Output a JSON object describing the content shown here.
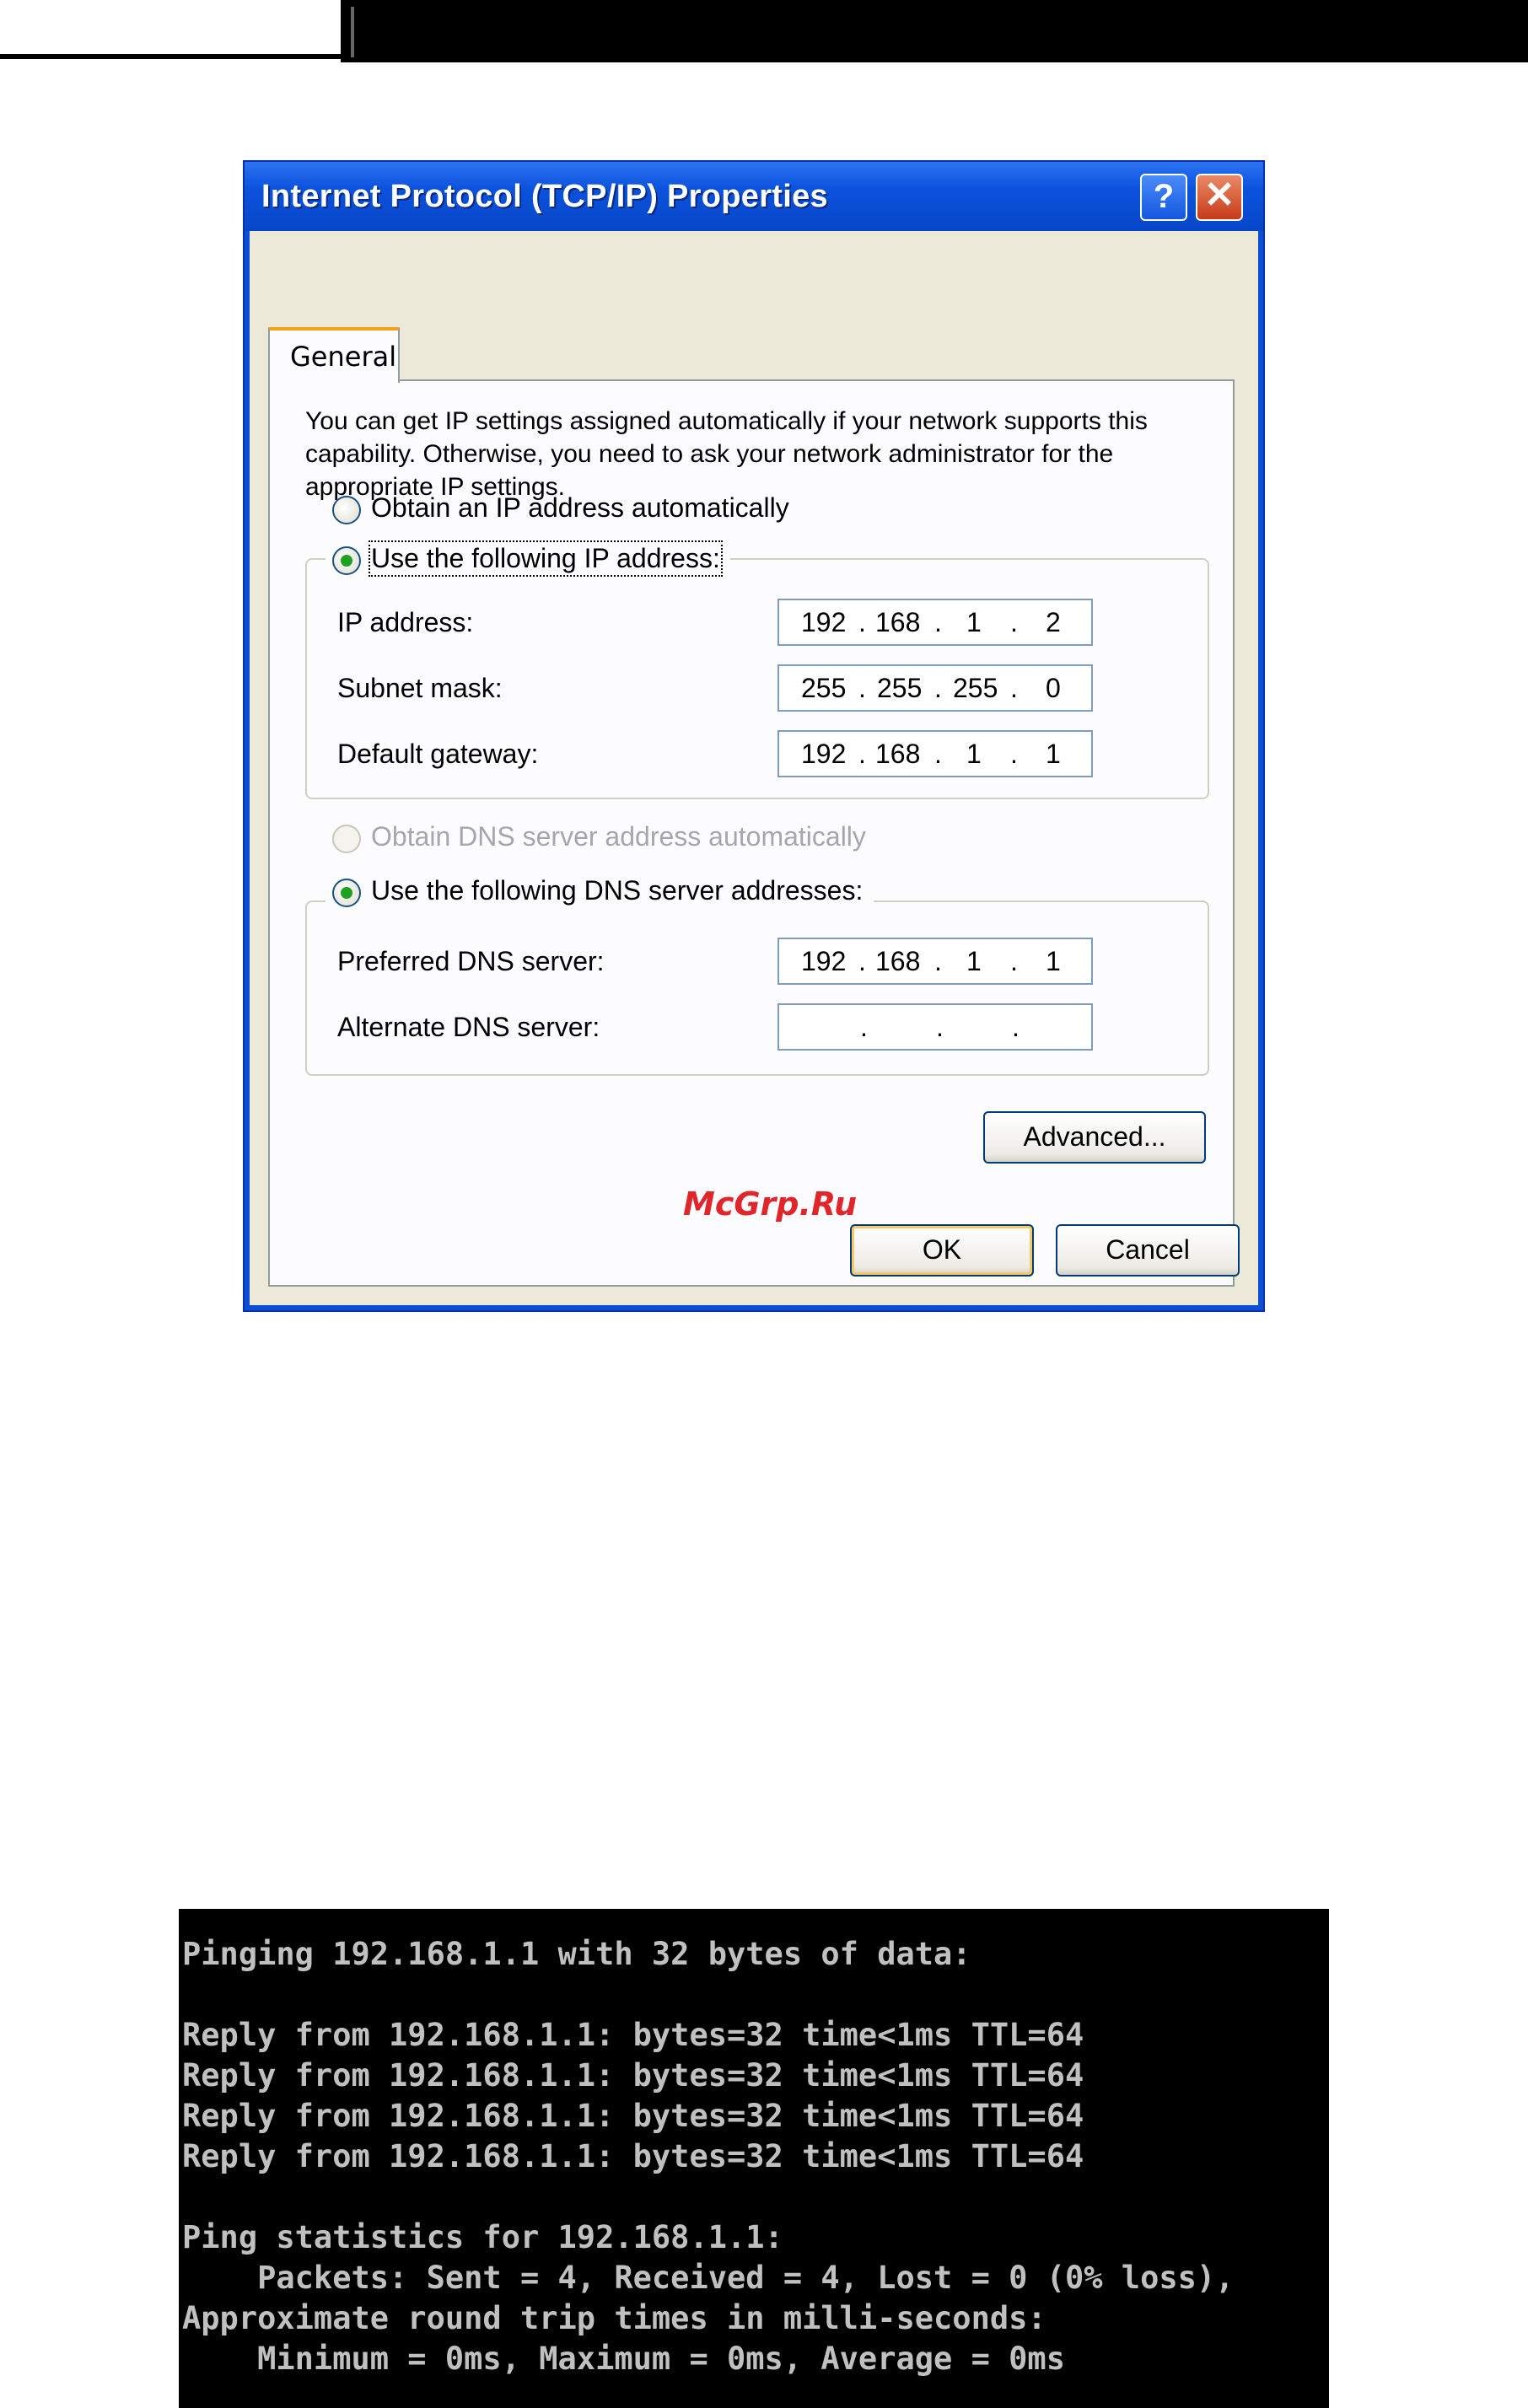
{
  "dialog": {
    "title": "Internet Protocol (TCP/IP) Properties",
    "help_label": "?",
    "close_label": "✕",
    "tab_general": "General",
    "intro_text": "You can get IP settings assigned automatically if your network supports this capability. Otherwise, you need to ask your network administrator for the appropriate IP settings.",
    "ip_auto_label": "Obtain an IP address automatically",
    "ip_manual_label": "Use the following IP address:",
    "ip_mode": "manual",
    "ip_fields": {
      "ip_label": "IP address:",
      "ip_value": [
        "192",
        "168",
        "1",
        "2"
      ],
      "mask_label": "Subnet mask:",
      "mask_value": [
        "255",
        "255",
        "255",
        "0"
      ],
      "gateway_label": "Default gateway:",
      "gateway_value": [
        "192",
        "168",
        "1",
        "1"
      ]
    },
    "dns_auto_label": "Obtain DNS server address automatically",
    "dns_manual_label": "Use the following DNS server addresses:",
    "dns_mode": "manual",
    "dns_fields": {
      "preferred_label": "Preferred DNS server:",
      "preferred_value": [
        "192",
        "168",
        "1",
        "1"
      ],
      "alternate_label": "Alternate DNS server:",
      "alternate_value": [
        "",
        "",
        "",
        ""
      ]
    },
    "advanced_button": "Advanced...",
    "ok_button": "OK",
    "cancel_button": "Cancel"
  },
  "watermark": "McGrp.Ru",
  "console": {
    "lines": [
      "Pinging 192.168.1.1 with 32 bytes of data:",
      "",
      "Reply from 192.168.1.1: bytes=32 time<1ms TTL=64",
      "Reply from 192.168.1.1: bytes=32 time<1ms TTL=64",
      "Reply from 192.168.1.1: bytes=32 time<1ms TTL=64",
      "Reply from 192.168.1.1: bytes=32 time<1ms TTL=64",
      "",
      "Ping statistics for 192.168.1.1:",
      "    Packets: Sent = 4, Received = 4, Lost = 0 (0% loss),",
      "Approximate round trip times in milli-seconds:",
      "    Minimum = 0ms, Maximum = 0ms, Average = 0ms"
    ]
  },
  "colors": {
    "titlebar": "#0a52dc",
    "dialog_bg": "#ece9d8",
    "console_bg": "#000000",
    "console_fg": "#c0c0c0",
    "watermark": "#e0262a"
  }
}
